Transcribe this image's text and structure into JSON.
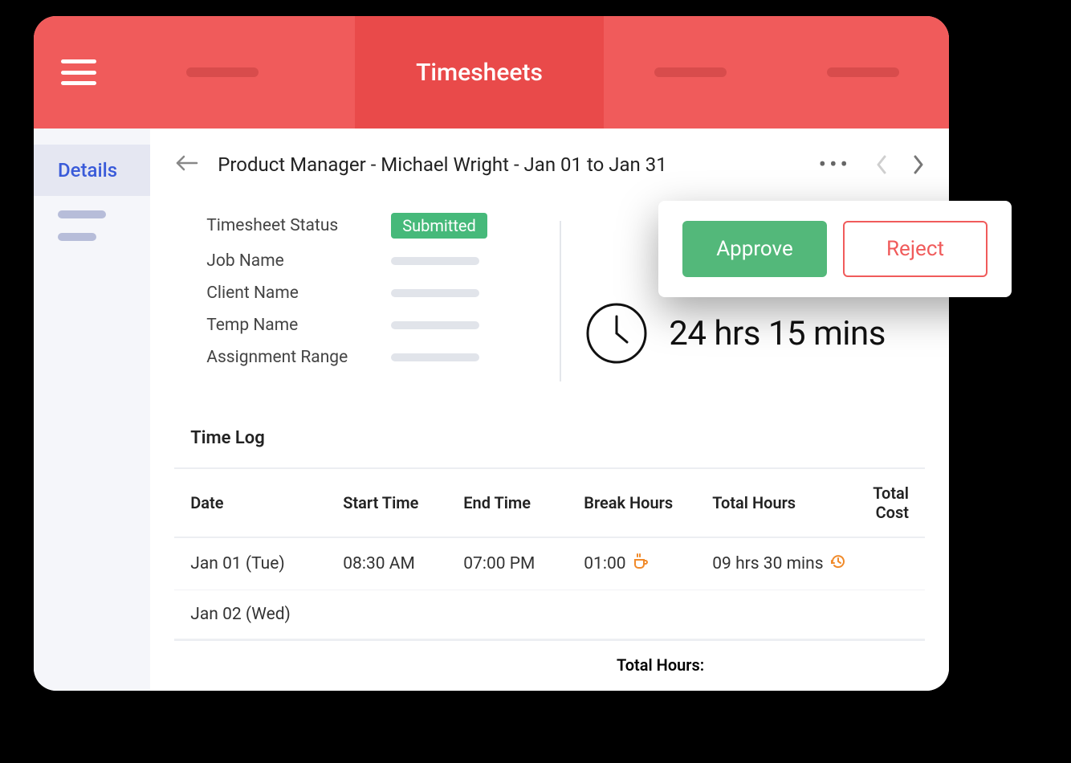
{
  "header": {
    "title": "Timesheets"
  },
  "sidebar": {
    "items": [
      {
        "label": "Details",
        "active": true
      }
    ]
  },
  "page": {
    "title": "Product Manager - Michael Wright  - Jan 01 to Jan 31"
  },
  "info": {
    "labels": {
      "status": "Timesheet Status",
      "job": "Job Name",
      "client": "Client Name",
      "temp": "Temp Name",
      "range": "Assignment Range"
    },
    "status_badge": "Submitted",
    "total_time": "24 hrs 15 mins"
  },
  "timelog": {
    "section_title": "Time Log",
    "columns": {
      "date": "Date",
      "start": "Start Time",
      "end": "End Time",
      "break": "Break Hours",
      "total": "Total Hours",
      "cost": "Total Cost"
    },
    "rows": [
      {
        "date": "Jan 01 (Tue)",
        "start": "08:30 AM",
        "end": "07:00 PM",
        "break": "01:00",
        "total": "09 hrs 30 mins"
      },
      {
        "date": "Jan 02 (Wed)"
      }
    ],
    "footer_label": "Total Hours:"
  },
  "actions": {
    "approve": "Approve",
    "reject": "Reject"
  }
}
